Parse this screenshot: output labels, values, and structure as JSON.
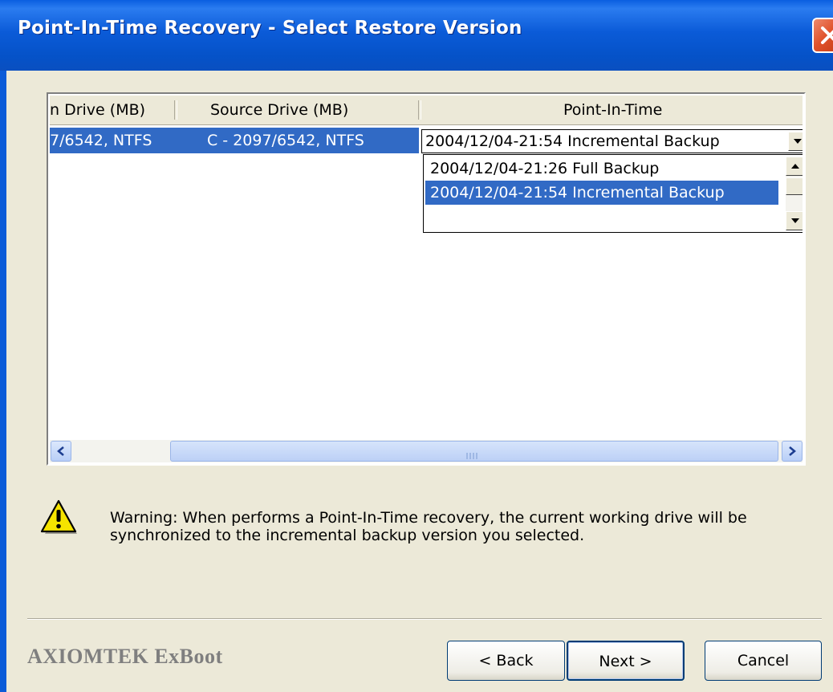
{
  "window": {
    "title": "Point-In-Time Recovery - Select Restore Version"
  },
  "list": {
    "columns": [
      "n Drive (MB)",
      "Source Drive (MB)",
      "Point-In-Time"
    ],
    "row": {
      "col1": "7/6542, NTFS",
      "col2": "C - 2097/6542, NTFS",
      "point_in_time": "2004/12/04-21:54 Incremental Backup"
    },
    "dropdown_options": [
      "2004/12/04-21:26 Full Backup",
      "2004/12/04-21:54 Incremental Backup"
    ],
    "selected_option_index": 1
  },
  "warning": {
    "text": "Warning: When performs a Point-In-Time recovery, the current working drive will be synchronized to the incremental backup version you selected.",
    "icon": "warning-icon"
  },
  "footer": {
    "brand": "AXIOMTEK ExBoot",
    "back_label": "< Back",
    "next_label": "Next >",
    "cancel_label": "Cancel"
  },
  "colors": {
    "title_bar": "#0B5BD8",
    "selection": "#316AC5",
    "dialog_bg": "#ECE9D8",
    "close_button": "#E0522B"
  }
}
